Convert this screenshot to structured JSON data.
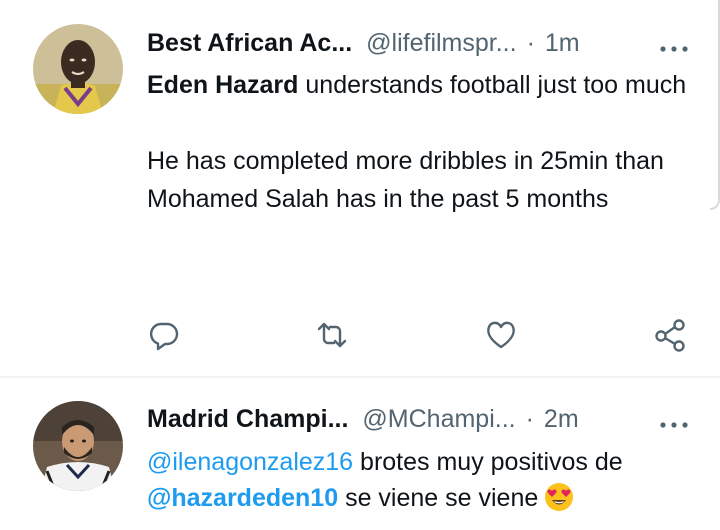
{
  "tweets": [
    {
      "display_name": "Best African Ac...",
      "handle": "@lifefilmspr...",
      "separator": "·",
      "time": "1m",
      "text": {
        "bold_name": "Eden Hazard",
        "line1_rest": " understands football just too much",
        "para2": "He has completed more dribbles in 25min than Mohamed Salah has in the past 5 months"
      }
    },
    {
      "display_name": "Madrid Champi...",
      "handle": "@MChampi...",
      "separator": "·",
      "time": "2m",
      "text": {
        "mention1": "@ilenagonzalez16",
        "part1": " brotes muy positivos de",
        "mention2": "@hazardeden10",
        "part2": " se viene se viene"
      }
    }
  ],
  "colors": {
    "accent": "#1d9bf0",
    "text": "#0f1419",
    "muted": "#536471",
    "divider": "#eff3f4"
  },
  "icons": [
    "reply-icon",
    "retweet-icon",
    "like-icon",
    "share-icon",
    "more-icon",
    "heart-eyes-emoji"
  ]
}
